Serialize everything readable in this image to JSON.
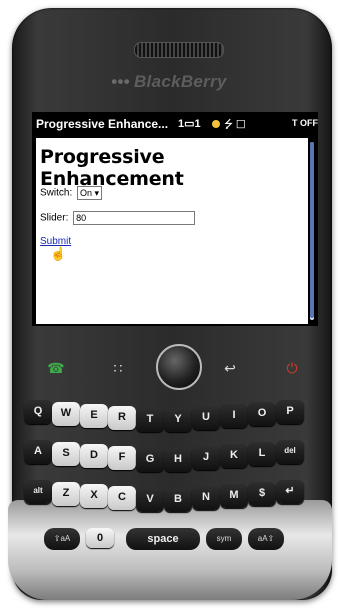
{
  "brand": {
    "logo_text": "BlackBerry"
  },
  "statusbar": {
    "title": "Progressive Enhance...",
    "signal": "1▭1",
    "icons": "⭍ ☐",
    "off_label": "T OFF"
  },
  "page": {
    "heading": "Progressive Enhancement",
    "switch_label": "Switch:",
    "switch_value": "On",
    "slider_label": "Slider:",
    "slider_value": "80",
    "submit_label": "Submit"
  },
  "keyboard": {
    "rows": [
      [
        "Q",
        "W",
        "E",
        "R",
        "T",
        "Y",
        "U",
        "I",
        "O",
        "P"
      ],
      [
        "A",
        "S",
        "D",
        "F",
        "G",
        "H",
        "J",
        "K",
        "L",
        "del"
      ],
      [
        "alt",
        "Z",
        "X",
        "C",
        "V",
        "B",
        "N",
        "M",
        "$",
        "↵"
      ]
    ],
    "space_label": "space",
    "sym_label": "sym",
    "aa_left": "⇧aA",
    "aa_right": "aA⇧",
    "zero": "0",
    "mic": "☺"
  }
}
